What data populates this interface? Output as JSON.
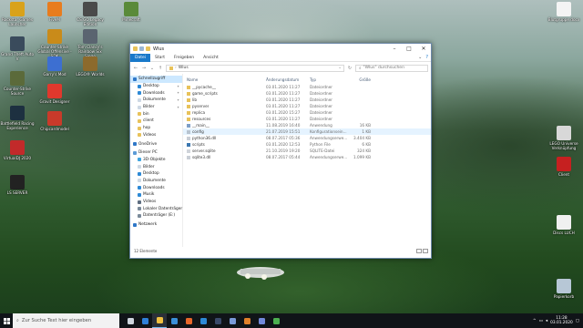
{
  "desktop": {
    "icons_left": [
      {
        "label": "Rockstar Games Launcher",
        "color": "#d9a21b"
      },
      {
        "label": "Grand Theft Auto V",
        "color": "#3a4b5c"
      },
      {
        "label": "Counter-Strike Source",
        "color": "#5b6a3a"
      },
      {
        "label": "Battlefield Racing Experience",
        "color": "#1d3040"
      },
      {
        "label": "VirtualDJ 2020",
        "color": "#c22a2a"
      },
      {
        "label": "LS SERVER",
        "color": "#222222"
      }
    ],
    "icons_col2": [
      {
        "label": "FiveM",
        "color": "#e87c1e"
      },
      {
        "label": "Counter-Strike Global Offensive - SDK",
        "color": "#c98b1a"
      },
      {
        "label": "Garry's Mod",
        "color": "#3d6fd1"
      },
      {
        "label": "Gravit Designer",
        "color": "#e0382d"
      },
      {
        "label": "Chipcardmodel",
        "color": "#c93a2a"
      }
    ],
    "icons_col3": [
      {
        "label": "CS:GO Legacy Edition",
        "color": "#4a4a4a"
      },
      {
        "label": "Tom Clancy's Rainbow Six Siege",
        "color": "#5a6470"
      },
      {
        "label": "LEGO® Worlds",
        "color": "#8c6a2c"
      }
    ],
    "icons_col4": [
      {
        "label": "Minecraft",
        "color": "#5a8a3a"
      }
    ],
    "icons_right": [
      {
        "label": "Blutgruppe.docx",
        "color": "#f4f4f4"
      },
      {
        "label": "LEGO Universe Verknüpfung",
        "color": "#d8d8d8"
      },
      {
        "label": "Client",
        "color": "#c62020"
      },
      {
        "label": "Discs LUCH",
        "color": "#f0f0f0"
      },
      {
        "label": "Papierkorb",
        "color": "#b7c7d6"
      }
    ]
  },
  "explorer": {
    "title": "Wlus",
    "ribbon_tabs": [
      "Datei",
      "Start",
      "Freigeben",
      "Ansicht"
    ],
    "address_path": [
      "Wlus"
    ],
    "search_placeholder": "\"Wlus\" durchsuchen",
    "nav_items": [
      {
        "label": "Schnellzugriff",
        "color": "#2e77c8",
        "pinned": false,
        "indent": 0
      },
      {
        "label": "Desktop",
        "color": "#2d89d6",
        "pinned": true,
        "indent": 1
      },
      {
        "label": "Downloads",
        "color": "#2d89d6",
        "pinned": true,
        "indent": 1
      },
      {
        "label": "Dokumente",
        "color": "#cdd8e4",
        "pinned": true,
        "indent": 1
      },
      {
        "label": "Bilder",
        "color": "#cdd8e4",
        "pinned": true,
        "indent": 1
      },
      {
        "label": "bin",
        "color": "#e8c25a",
        "pinned": false,
        "indent": 1
      },
      {
        "label": "client",
        "color": "#e8c25a",
        "pinned": false,
        "indent": 1
      },
      {
        "label": "hop",
        "color": "#e8c25a",
        "pinned": false,
        "indent": 1
      },
      {
        "label": "Videos",
        "color": "#e8c25a",
        "pinned": false,
        "indent": 1
      },
      {
        "label": "OneDrive",
        "color": "#2e77c8",
        "pinned": false,
        "indent": 0
      },
      {
        "label": "Dieser PC",
        "color": "#5c9bd6",
        "pinned": false,
        "indent": 0
      },
      {
        "label": "3D-Objekte",
        "color": "#3fa4e0",
        "pinned": false,
        "indent": 1
      },
      {
        "label": "Bilder",
        "color": "#cdd8e4",
        "pinned": false,
        "indent": 1
      },
      {
        "label": "Desktop",
        "color": "#2d89d6",
        "pinned": false,
        "indent": 1
      },
      {
        "label": "Dokumente",
        "color": "#cdd8e4",
        "pinned": false,
        "indent": 1
      },
      {
        "label": "Downloads",
        "color": "#2d89d6",
        "pinned": false,
        "indent": 1
      },
      {
        "label": "Musik",
        "color": "#2d89d6",
        "pinned": false,
        "indent": 1
      },
      {
        "label": "Videos",
        "color": "#5d6d80",
        "pinned": false,
        "indent": 1
      },
      {
        "label": "Lokaler Datenträger",
        "color": "#7a8a9a",
        "pinned": false,
        "indent": 1
      },
      {
        "label": "Datenträger (E:)",
        "color": "#7a8a9a",
        "pinned": false,
        "indent": 1
      },
      {
        "label": "Netzwerk",
        "color": "#2e77c8",
        "pinned": false,
        "indent": 0
      }
    ],
    "columns": [
      "Name",
      "Änderungsdatum",
      "Typ",
      "Größe"
    ],
    "files": [
      {
        "name": "__pycache__",
        "date": "03.01.2020 11:27",
        "type": "Dateiordner",
        "size": "",
        "kind": "folder"
      },
      {
        "name": "game_scripts",
        "date": "03.01.2020 11:27",
        "type": "Dateiordner",
        "size": "",
        "kind": "folder"
      },
      {
        "name": "lib",
        "date": "03.01.2020 11:27",
        "type": "Dateiordner",
        "size": "",
        "kind": "folder"
      },
      {
        "name": "pyserver",
        "date": "03.01.2020 11:27",
        "type": "Dateiordner",
        "size": "",
        "kind": "folder"
      },
      {
        "name": "replica",
        "date": "03.01.2020 15:27",
        "type": "Dateiordner",
        "size": "",
        "kind": "folder"
      },
      {
        "name": "resources",
        "date": "03.01.2020 11:27",
        "type": "Dateiordner",
        "size": "",
        "kind": "folder"
      },
      {
        "name": "__main__",
        "date": "11.08.2019 16:40",
        "type": "Anwendung",
        "size": "16 KB",
        "kind": "exe"
      },
      {
        "name": "config",
        "date": "21.07.2019 15:51",
        "type": "Konfigurationsein...",
        "size": "1 KB",
        "kind": "cfg"
      },
      {
        "name": "python36.dll",
        "date": "08.07.2017 05:36",
        "type": "Anwendungserwe...",
        "size": "3.404 KB",
        "kind": "dll"
      },
      {
        "name": "scripts",
        "date": "03.01.2020 12:53",
        "type": "Python File",
        "size": "6 KB",
        "kind": "py"
      },
      {
        "name": "server.sqlite",
        "date": "21.10.2019 19:20",
        "type": "SQLITE-Datei",
        "size": "324 KB",
        "kind": "db"
      },
      {
        "name": "sqlite3.dll",
        "date": "08.07.2017 05:44",
        "type": "Anwendungserwe...",
        "size": "1.099 KB",
        "kind": "dll"
      }
    ],
    "status": "12 Elemente"
  },
  "taskbar": {
    "search_placeholder": "Zur Suche Text hier eingeben",
    "apps": [
      {
        "name": "task-view",
        "color": "#cfd6de"
      },
      {
        "name": "edge",
        "color": "#2f80d8"
      },
      {
        "name": "file-explorer",
        "color": "#f0c040"
      },
      {
        "name": "store",
        "color": "#3a8fd8"
      },
      {
        "name": "firefox",
        "color": "#e8672a"
      },
      {
        "name": "mail",
        "color": "#2d89d6"
      },
      {
        "name": "steam",
        "color": "#3a4a6a"
      },
      {
        "name": "photos",
        "color": "#7a9ad8"
      },
      {
        "name": "media-player",
        "color": "#e0802a"
      },
      {
        "name": "discord",
        "color": "#7289da"
      },
      {
        "name": "chrome",
        "color": "#4caf50"
      }
    ],
    "clock_time": "11:28",
    "clock_date": "03.01.2020"
  }
}
